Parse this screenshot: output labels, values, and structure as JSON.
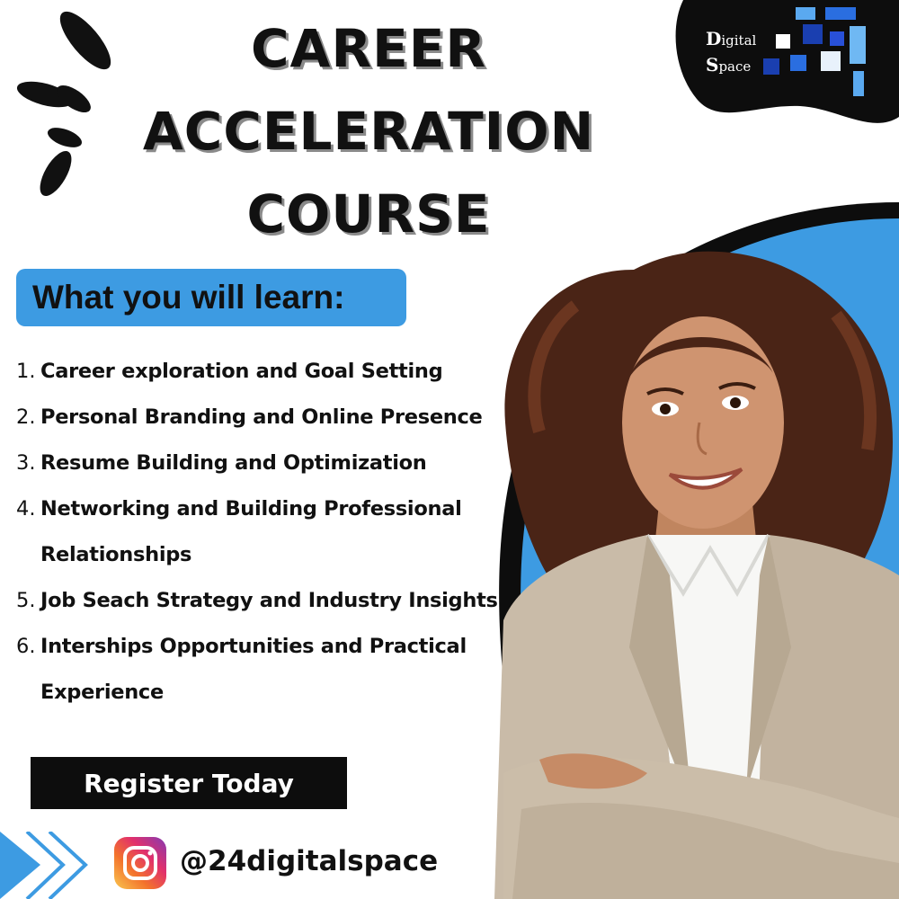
{
  "title": {
    "lines": [
      "CAREER",
      "ACCELERATION",
      "COURSE"
    ]
  },
  "brand": {
    "first_letter_1": "D",
    "rest_1": "igital",
    "first_letter_2": "S",
    "rest_2": "pace"
  },
  "learn": {
    "heading": "What you will learn:",
    "items": [
      {
        "num": "1.",
        "text": "Career exploration and Goal Setting"
      },
      {
        "num": "2.",
        "text": "Personal Branding and Online Presence"
      },
      {
        "num": "3.",
        "text": "Resume Building and Optimization"
      },
      {
        "num": "4.",
        "text": "Networking and Building Professional",
        "cont": "Relationships"
      },
      {
        "num": "5.",
        "text": "Job Seach Strategy and Industry Insights"
      },
      {
        "num": "6.",
        "text": "Interships Opportunities and Practical",
        "cont": "Experience"
      }
    ]
  },
  "cta": {
    "register_label": "Register Today"
  },
  "social": {
    "icon": "instagram-icon",
    "handle": "@24digitalspace"
  },
  "colors": {
    "accent_blue": "#3d9be2",
    "black": "#0d0d0d",
    "blazer": "#c9bba8",
    "hair": "#4a2416"
  }
}
